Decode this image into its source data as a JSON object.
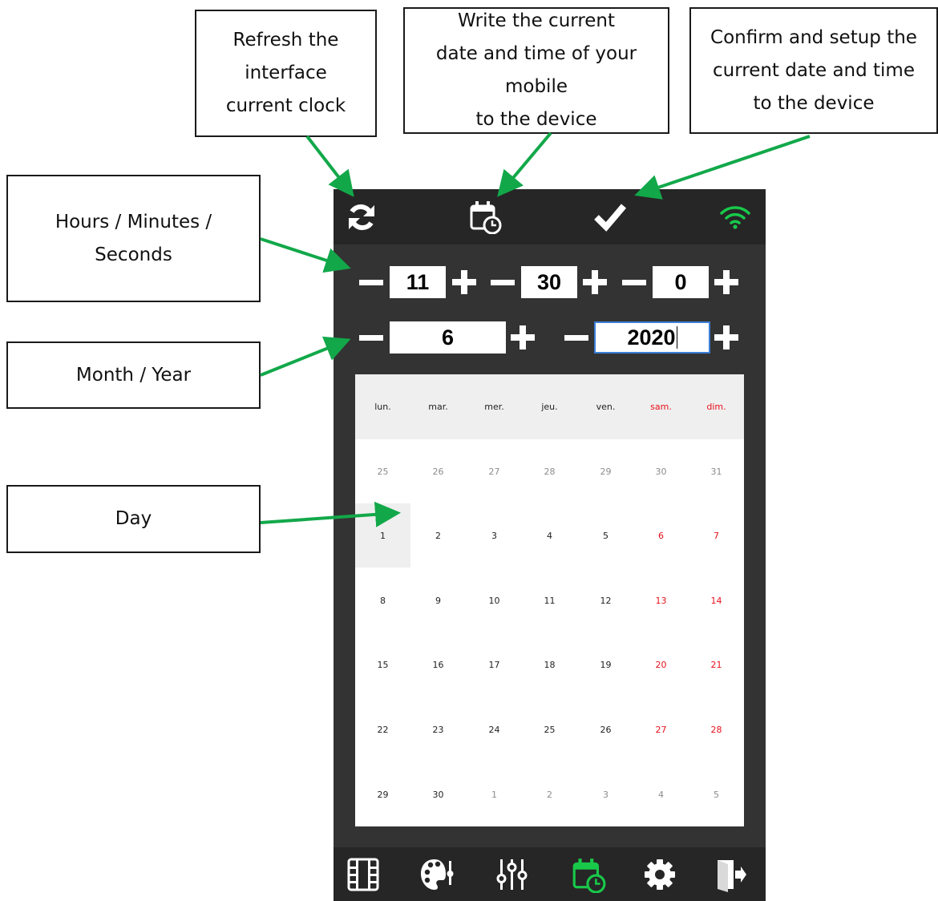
{
  "callouts": {
    "refresh": [
      "Refresh the",
      "interface",
      "current clock"
    ],
    "write_mobile_time": [
      "Write the current",
      "date and time of your mobile",
      "to the device"
    ],
    "confirm": [
      "Confirm and setup the",
      "current date and time",
      "to the device"
    ],
    "hms": [
      "Hours / Minutes /",
      "Seconds"
    ],
    "month_year": [
      "Month / Year"
    ],
    "day": [
      "Day"
    ]
  },
  "annotation_color": "#12a84a",
  "topbar": {
    "icons": [
      "refresh-icon",
      "calendar-clock-icon",
      "checkmark-icon",
      "wifi-icon"
    ],
    "wifi_color": "#18c94a"
  },
  "time": {
    "hours": "11",
    "minutes": "30",
    "seconds": "0"
  },
  "date": {
    "month": "6",
    "year": "2020"
  },
  "calendar": {
    "weekdays": [
      "lun.",
      "mar.",
      "mer.",
      "jeu.",
      "ven.",
      "sam.",
      "dim."
    ],
    "weeks": [
      [
        "25",
        "26",
        "27",
        "28",
        "29",
        "30",
        "31"
      ],
      [
        "1",
        "2",
        "3",
        "4",
        "5",
        "6",
        "7"
      ],
      [
        "8",
        "9",
        "10",
        "11",
        "12",
        "13",
        "14"
      ],
      [
        "15",
        "16",
        "17",
        "18",
        "19",
        "20",
        "21"
      ],
      [
        "22",
        "23",
        "24",
        "25",
        "26",
        "27",
        "28"
      ],
      [
        "29",
        "30",
        "1",
        "2",
        "3",
        "4",
        "5"
      ]
    ],
    "selected_day": "1",
    "weekend_color": "#e8101a"
  },
  "bottom_nav": {
    "icons": [
      "film-icon",
      "palette-icon",
      "sliders-icon",
      "calendar-clock-icon",
      "gear-icon",
      "exit-icon"
    ],
    "active_index": 3,
    "active_color": "#18c94a"
  }
}
